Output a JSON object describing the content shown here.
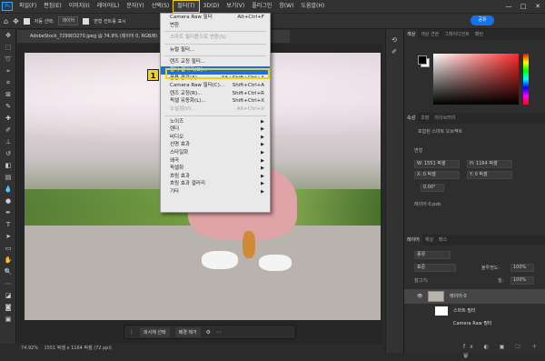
{
  "menubar": {
    "logo": "Ps",
    "items": [
      "파일(F)",
      "편집(E)",
      "이미지(I)",
      "레이어(L)",
      "문자(Y)",
      "선택(S)",
      "필터(T)",
      "3D(D)",
      "보기(V)",
      "플러그인",
      "창(W)",
      "도움말(H)"
    ],
    "active_index": 6,
    "window_controls": [
      "—",
      "□",
      "✕"
    ]
  },
  "optionsbar": {
    "auto_select": "자동 선택:",
    "layer_option": "레이어",
    "transform": "변형 컨트롤 표시",
    "share": "공유"
  },
  "document": {
    "tab_title": "AdobeStock_729903270.jpeg @ 74.9% (레이어 0, RGB/8)",
    "status_zoom": "74.92%",
    "status_size": "1551 픽셀 x 1164 픽셀 (72 ppi)"
  },
  "taskbar": {
    "select_subject": "피사체 선택",
    "remove_bg": "배경 제거"
  },
  "filter_menu": {
    "items": [
      {
        "label": "Camera Raw 필터",
        "shortcut": "Alt+Ctrl+F",
        "disabled": false
      },
      {
        "label": "변환",
        "shortcut": "",
        "disabled": false
      },
      {
        "sep": true
      },
      {
        "label": "스마트 필터용으로 변환(S)",
        "shortcut": "",
        "disabled": true
      },
      {
        "sep": true
      },
      {
        "label": "뉴럴 필터...",
        "shortcut": "",
        "disabled": false
      },
      {
        "sep": true
      },
      {
        "label": "렌즈 교정 필터...",
        "shortcut": "",
        "disabled": false
      },
      {
        "label": "필터 갤러리(G)...",
        "shortcut": "",
        "disabled": false,
        "highlight": true
      },
      {
        "label": "응용 광각(A)...",
        "shortcut": "Alt+Shift+Ctrl+A",
        "disabled": false
      },
      {
        "label": "Camera Raw 필터(C)...",
        "shortcut": "Shift+Ctrl+A",
        "disabled": false
      },
      {
        "label": "렌즈 교정(R)...",
        "shortcut": "Shift+Ctrl+R",
        "disabled": false
      },
      {
        "label": "픽셀 유동화(L)...",
        "shortcut": "Shift+Ctrl+X",
        "disabled": false
      },
      {
        "label": "소실점(V)...",
        "shortcut": "Alt+Ctrl+V",
        "disabled": true
      },
      {
        "sep": true
      },
      {
        "label": "노이즈",
        "shortcut": "",
        "sub": true
      },
      {
        "label": "렌더",
        "shortcut": "",
        "sub": true
      },
      {
        "label": "비디오",
        "shortcut": "",
        "sub": true
      },
      {
        "label": "선명 효과",
        "shortcut": "",
        "sub": true
      },
      {
        "label": "스타일화",
        "shortcut": "",
        "sub": true
      },
      {
        "label": "왜곡",
        "shortcut": "",
        "sub": true
      },
      {
        "label": "픽셀화",
        "shortcut": "",
        "sub": true
      },
      {
        "label": "흐림 효과",
        "shortcut": "",
        "sub": true
      },
      {
        "label": "흐림 효과 갤러리",
        "shortcut": "",
        "sub": true
      },
      {
        "label": "기타",
        "shortcut": "",
        "sub": true
      }
    ],
    "callout": "1"
  },
  "panels": {
    "color_tabs": [
      "색상",
      "색상 견본",
      "그레이디언트",
      "패턴"
    ],
    "props_tabs": [
      "속성",
      "조정",
      "라이브러리"
    ],
    "smart_object": "포함된 스마트 오브젝트",
    "transform_label": "변형",
    "w_label": "W: 1551 픽셀",
    "h_label": "H: 1164 픽셀",
    "x_label": "X: 0 픽셀",
    "y_label": "Y: 0 픽셀",
    "angle": "0.00°",
    "file_name": "레이어 0.psb",
    "layers_tabs": [
      "레이어",
      "채널",
      "패스"
    ],
    "kind": "종류",
    "blend_mode": "표준",
    "opacity_label": "불투명도:",
    "opacity_value": "100%",
    "fill_label": "칠:",
    "fill_value": "100%",
    "lock_label": "잠그기:",
    "layer_name": "레이어 0",
    "smart_filter": "스마트 필터",
    "camera_raw": "Camera Raw 필터"
  }
}
